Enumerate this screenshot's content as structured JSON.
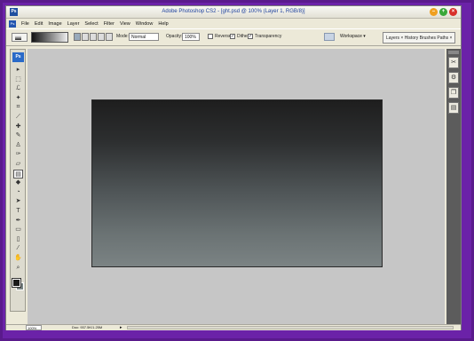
{
  "window": {
    "title": "Adobe Photoshop CS2 - [ght.psd @ 100% (Layer 1, RGB/8)]",
    "app_icon": "Ps",
    "buttons": {
      "minimize": "–",
      "maximize": "+",
      "close": "×"
    }
  },
  "menubar": {
    "items": [
      "File",
      "Edit",
      "Image",
      "Layer",
      "Select",
      "Filter",
      "View",
      "Window",
      "Help"
    ]
  },
  "options": {
    "mode_label": "Mode:",
    "mode_value": "Normal",
    "opacity_label": "Opacity:",
    "opacity_value": "100%",
    "reverse_label": "Reverse",
    "reverse_checked": "",
    "dither_label": "Dither",
    "dither_checked": "✓",
    "transparency_label": "Transparency",
    "transparency_checked": "✓",
    "workspace_label": "Workspace ▾",
    "palette_well": "Layers × History  Brushes  Paths  ×"
  },
  "toolbox": {
    "logo": "Ps",
    "tools": [
      {
        "name": "move-tool-icon",
        "glyph": "▸"
      },
      {
        "name": "marquee-tool-icon",
        "glyph": "⬚"
      },
      {
        "name": "lasso-tool-icon",
        "glyph": "ℒ"
      },
      {
        "name": "magic-wand-tool-icon",
        "glyph": "✦"
      },
      {
        "name": "crop-tool-icon",
        "glyph": "⌗"
      },
      {
        "name": "slice-tool-icon",
        "glyph": "⟋"
      },
      {
        "name": "healing-brush-tool-icon",
        "glyph": "✚"
      },
      {
        "name": "brush-tool-icon",
        "glyph": "✎"
      },
      {
        "name": "clone-stamp-tool-icon",
        "glyph": "♙"
      },
      {
        "name": "history-brush-tool-icon",
        "glyph": "✑"
      },
      {
        "name": "eraser-tool-icon",
        "glyph": "▱"
      },
      {
        "name": "gradient-tool-icon",
        "glyph": "▤"
      },
      {
        "name": "blur-tool-icon",
        "glyph": "◆"
      },
      {
        "name": "dodge-tool-icon",
        "glyph": "◔"
      },
      {
        "name": "path-selection-tool-icon",
        "glyph": "➤"
      },
      {
        "name": "type-tool-icon",
        "glyph": "T"
      },
      {
        "name": "pen-tool-icon",
        "glyph": "✒"
      },
      {
        "name": "shape-tool-icon",
        "glyph": "▭"
      },
      {
        "name": "notes-tool-icon",
        "glyph": "▯"
      },
      {
        "name": "eyedropper-tool-icon",
        "glyph": "⁄"
      },
      {
        "name": "hand-tool-icon",
        "glyph": "✋"
      },
      {
        "name": "zoom-tool-icon",
        "glyph": "⌕"
      }
    ]
  },
  "colors": {
    "foreground": "#1a1a1a",
    "background": "#7a8585",
    "workspace_bg": "#c6c6c6",
    "frame": "#6b22a8"
  },
  "dock": {
    "buttons": [
      "brush-panel-icon",
      "tool-presets-icon",
      "layer-comps-icon",
      "navigator-icon"
    ]
  },
  "status": {
    "zoom": "100%",
    "doc_info": "Doc: 937.5K/1.25M",
    "arrow": "▸"
  }
}
